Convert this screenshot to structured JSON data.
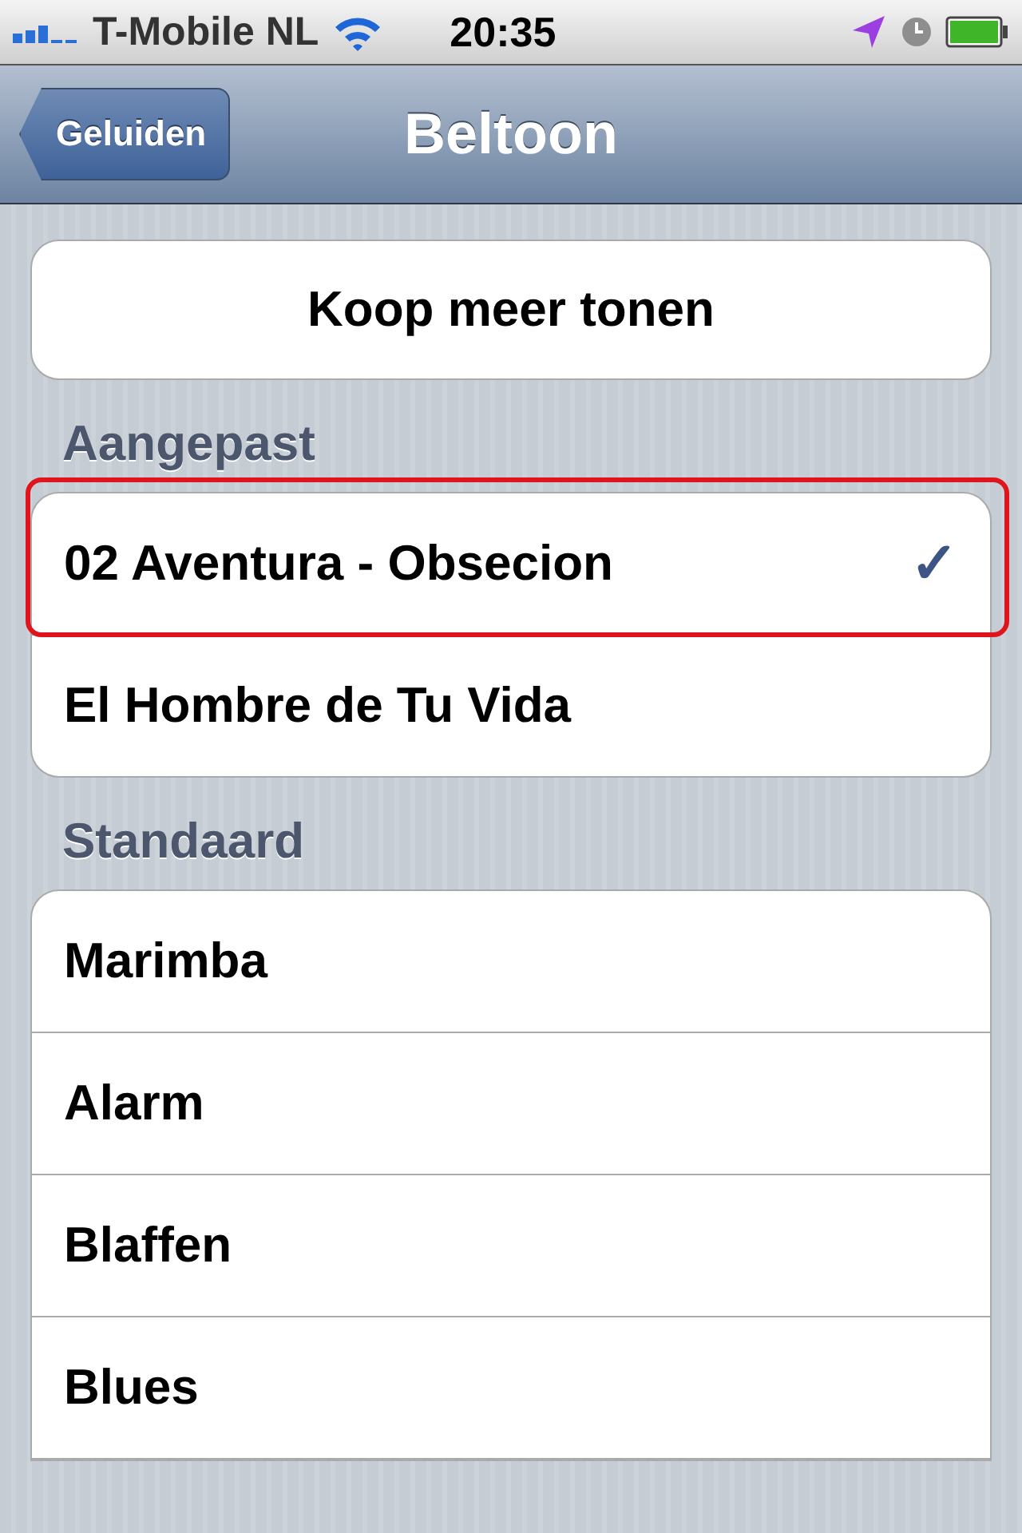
{
  "status_bar": {
    "carrier": "T-Mobile NL",
    "time": "20:35"
  },
  "nav_bar": {
    "back": "Geluiden",
    "title": "Beltoon"
  },
  "buy_button": "Koop meer tonen",
  "sections": [
    {
      "header": "Aangepast",
      "items": [
        {
          "label": "02 Aventura - Obsecion",
          "selected": true,
          "highlighted": true
        },
        {
          "label": "El Hombre de Tu Vida",
          "selected": false,
          "highlighted": false
        }
      ]
    },
    {
      "header": "Standaard",
      "items": [
        {
          "label": "Marimba",
          "selected": false,
          "highlighted": false
        },
        {
          "label": "Alarm",
          "selected": false,
          "highlighted": false
        },
        {
          "label": "Blaffen",
          "selected": false,
          "highlighted": false
        },
        {
          "label": "Blues",
          "selected": false,
          "highlighted": false
        }
      ]
    }
  ],
  "checkmark": "✓"
}
